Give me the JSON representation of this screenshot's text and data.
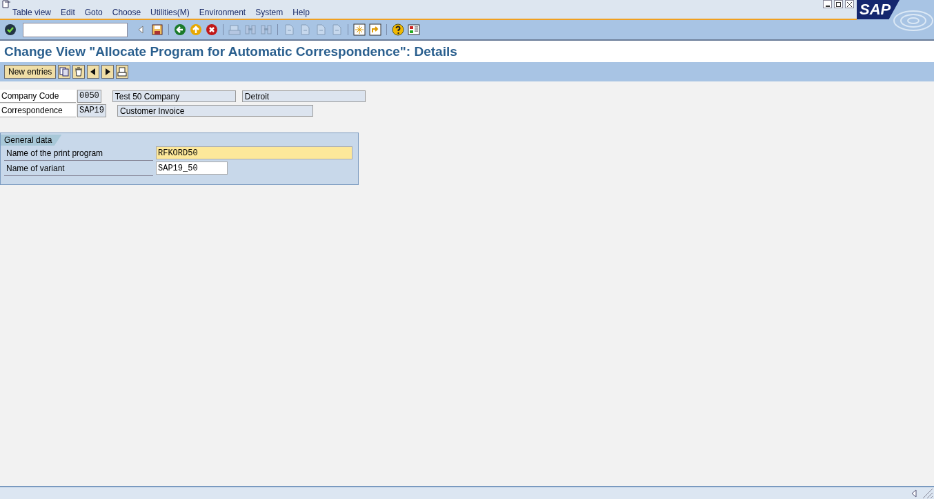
{
  "menu": [
    "Table view",
    "Edit",
    "Goto",
    "Choose",
    "Utilities(M)",
    "Environment",
    "System",
    "Help"
  ],
  "logo": "SAP",
  "toolbar": [
    [
      {
        "kind": "enter",
        "disabled": false
      }
    ],
    [
      {
        "kind": "triangle",
        "disabled": false
      },
      {
        "kind": "save",
        "disabled": false
      }
    ],
    [
      {
        "kind": "back",
        "disabled": false
      },
      {
        "kind": "exit",
        "disabled": false
      },
      {
        "kind": "cancel",
        "disabled": false
      }
    ],
    [
      {
        "kind": "print",
        "disabled": true
      },
      {
        "kind": "find",
        "disabled": true
      },
      {
        "kind": "find-next",
        "disabled": true
      }
    ],
    [
      {
        "kind": "page",
        "disabled": true
      },
      {
        "kind": "page",
        "disabled": true
      },
      {
        "kind": "page",
        "disabled": true
      },
      {
        "kind": "page",
        "disabled": true
      }
    ],
    [
      {
        "kind": "session",
        "disabled": false
      },
      {
        "kind": "shortcut",
        "disabled": false
      }
    ],
    [
      {
        "kind": "help",
        "disabled": false
      },
      {
        "kind": "layout",
        "disabled": false
      }
    ]
  ],
  "title": "Change View \"Allocate Program for Automatic Correspondence\": Details",
  "app_toolbar": {
    "button": "New entries",
    "icons": [
      {
        "kind": "copy"
      },
      {
        "kind": "delete"
      },
      {
        "kind": "previous"
      },
      {
        "kind": "next"
      },
      {
        "kind": "print"
      }
    ]
  },
  "header_rows": [
    {
      "label": "Company Code",
      "key": "0050",
      "texts": [
        "Test 50 Company",
        "Detroit"
      ]
    },
    {
      "label": "Correspondence",
      "key": "SAP19",
      "texts": [
        "Customer Invoice"
      ]
    }
  ],
  "group": {
    "title": "General data",
    "fields": [
      {
        "label": "Name of the print program",
        "value": "RFKORD50",
        "focused": true
      },
      {
        "label": "Name of variant",
        "value": "SAP19_50",
        "focused": false
      }
    ]
  }
}
